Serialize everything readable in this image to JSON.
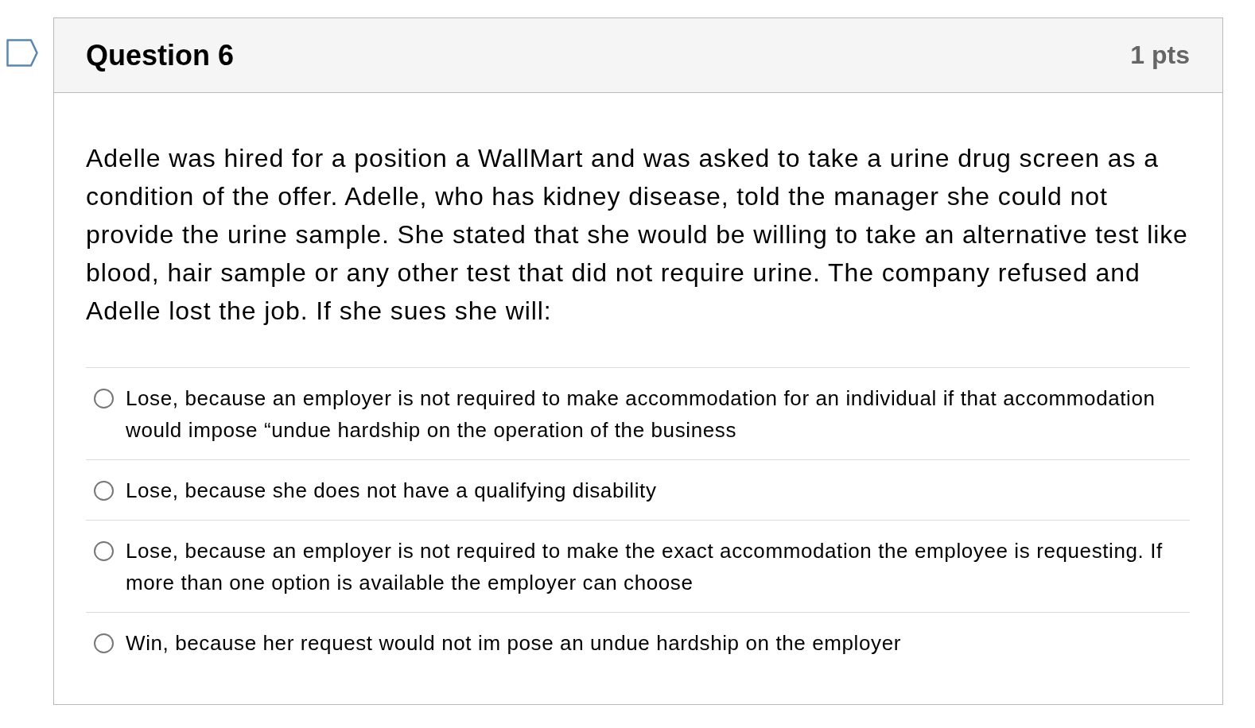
{
  "question": {
    "title": "Question 6",
    "points": "1 pts",
    "flagged": false
  },
  "prompt": "Adelle was hired for a position a WallMart and was asked to take a urine drug screen as a condition of the offer. Adelle, who has kidney disease, told the manager she could not provide the urine sample. She stated that she would be willing to take an alternative test like blood, hair sample or any other test that did not require urine. The company refused and Adelle lost the job. If she sues she will:",
  "answers": [
    {
      "text": "Lose, because an employer is not required to make accommodation for an individual if that accommodation would impose “undue hardship on the operation of the business",
      "selected": false
    },
    {
      "text": "Lose, because she does not have a qualifying disability",
      "selected": false
    },
    {
      "text": "Lose, because an employer is not required to make the exact accommodation the employee is requesting. If more than one option is available the employer can choose",
      "selected": false
    },
    {
      "text": "Win, because her request would not im pose an undue hardship on the employer",
      "selected": false
    }
  ]
}
